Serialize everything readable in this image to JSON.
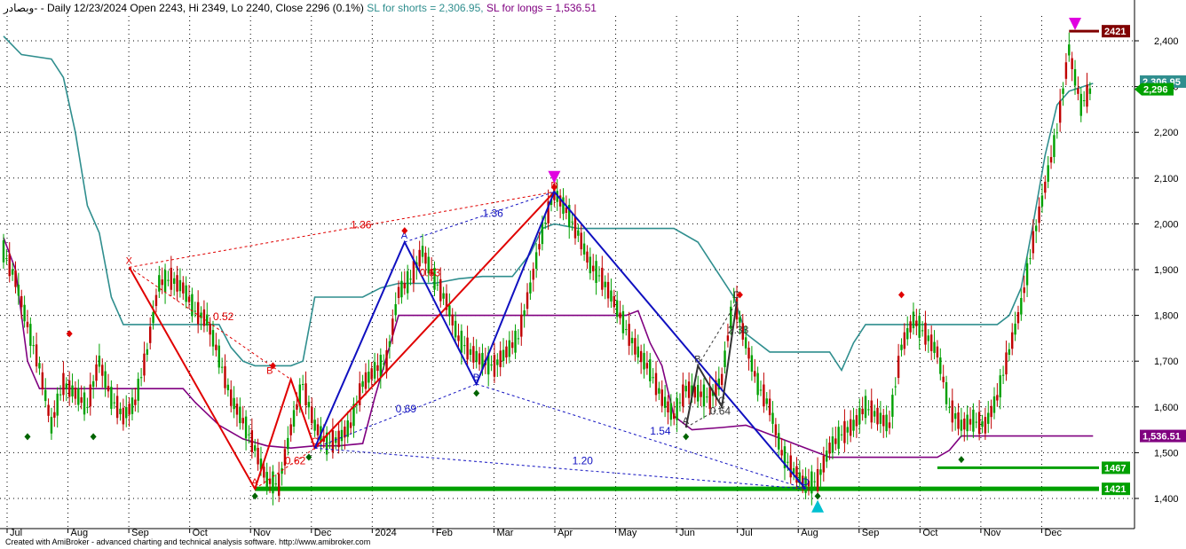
{
  "header": {
    "symbol": "وبصادر-",
    "ohlc_text": "- Daily 12/23/2024 Open 2243, Hi 2349, Lo 2240, Close 2296 (0.1%)",
    "sl_shorts_label": "SL for shorts",
    "sl_shorts_value": " = 2,306.95,",
    "sl_longs_label": "SL for longs",
    "sl_longs_value": " = 1,536.51"
  },
  "footer": "Created with AmiBroker - advanced charting and technical analysis software. http://www.amibroker.com",
  "chart_data": {
    "type": "line",
    "title": "Daily 12/23/2024 Open 2243, Hi 2349, Lo 2240, Close 2296 (0.1%)",
    "ylim": [
      1370,
      2440
    ],
    "y_ticks": [
      1400,
      1500,
      1600,
      1700,
      1800,
      1900,
      2000,
      2100,
      2200,
      2300,
      2400
    ],
    "y_tick_labels": [
      "1,400",
      "1,500",
      "1,600",
      "1,700",
      "1,800",
      "1,900",
      "2,000",
      "2,100",
      "2,200",
      "2,300",
      "2,400"
    ],
    "x_ticks": [
      "Jul",
      "Aug",
      "Sep",
      "Oct",
      "Nov",
      "Dec",
      "2024",
      "Feb",
      "Mar",
      "Apr",
      "May",
      "Jun",
      "Jul",
      "Aug",
      "Sep",
      "Oct",
      "Nov",
      "Dec"
    ],
    "grid": true,
    "colors": {
      "price": "#00a000",
      "sl_shorts": "#2f8e8e",
      "sl_longs": "#800080",
      "pattern_red": "#e00000",
      "pattern_blue": "#1010c0",
      "pattern_dark": "#333333",
      "support": "#00a000",
      "resistance": "#800000",
      "sell_marker": "#e000e0",
      "buy_marker": "#00c0d0"
    },
    "price_points": [
      [
        0,
        1940
      ],
      [
        4,
        1880
      ],
      [
        8,
        1780
      ],
      [
        12,
        1690
      ],
      [
        16,
        1560
      ],
      [
        20,
        1650
      ],
      [
        24,
        1630
      ],
      [
        28,
        1600
      ],
      [
        32,
        1700
      ],
      [
        36,
        1620
      ],
      [
        40,
        1580
      ],
      [
        44,
        1610
      ],
      [
        48,
        1720
      ],
      [
        52,
        1870
      ],
      [
        56,
        1880
      ],
      [
        60,
        1860
      ],
      [
        64,
        1810
      ],
      [
        68,
        1790
      ],
      [
        72,
        1710
      ],
      [
        76,
        1620
      ],
      [
        80,
        1570
      ],
      [
        84,
        1510
      ],
      [
        88,
        1440
      ],
      [
        92,
        1430
      ],
      [
        96,
        1550
      ],
      [
        100,
        1650
      ],
      [
        104,
        1560
      ],
      [
        108,
        1520
      ],
      [
        112,
        1530
      ],
      [
        116,
        1560
      ],
      [
        120,
        1650
      ],
      [
        124,
        1680
      ],
      [
        128,
        1700
      ],
      [
        132,
        1850
      ],
      [
        136,
        1880
      ],
      [
        140,
        1940
      ],
      [
        144,
        1880
      ],
      [
        148,
        1830
      ],
      [
        152,
        1750
      ],
      [
        156,
        1720
      ],
      [
        160,
        1700
      ],
      [
        164,
        1690
      ],
      [
        168,
        1720
      ],
      [
        172,
        1750
      ],
      [
        176,
        1860
      ],
      [
        180,
        1980
      ],
      [
        184,
        2070
      ],
      [
        188,
        2030
      ],
      [
        192,
        1980
      ],
      [
        196,
        1910
      ],
      [
        200,
        1880
      ],
      [
        204,
        1830
      ],
      [
        208,
        1770
      ],
      [
        212,
        1720
      ],
      [
        216,
        1680
      ],
      [
        220,
        1620
      ],
      [
        224,
        1580
      ],
      [
        228,
        1640
      ],
      [
        232,
        1630
      ],
      [
        236,
        1620
      ],
      [
        240,
        1660
      ],
      [
        244,
        1840
      ],
      [
        248,
        1740
      ],
      [
        252,
        1650
      ],
      [
        256,
        1600
      ],
      [
        260,
        1500
      ],
      [
        264,
        1460
      ],
      [
        268,
        1430
      ],
      [
        272,
        1440
      ],
      [
        276,
        1510
      ],
      [
        280,
        1540
      ],
      [
        284,
        1560
      ],
      [
        288,
        1600
      ],
      [
        292,
        1580
      ],
      [
        296,
        1560
      ],
      [
        300,
        1730
      ],
      [
        304,
        1790
      ],
      [
        308,
        1760
      ],
      [
        312,
        1720
      ],
      [
        316,
        1600
      ],
      [
        320,
        1560
      ],
      [
        324,
        1570
      ],
      [
        328,
        1560
      ],
      [
        332,
        1620
      ],
      [
        336,
        1720
      ],
      [
        340,
        1820
      ],
      [
        344,
        1960
      ],
      [
        348,
        2080
      ],
      [
        352,
        2200
      ],
      [
        356,
        2380
      ],
      [
        360,
        2260
      ],
      [
        364,
        2300
      ]
    ],
    "sl_shorts_series": [
      [
        0,
        2410
      ],
      [
        6,
        2370
      ],
      [
        16,
        2360
      ],
      [
        20,
        2320
      ],
      [
        24,
        2200
      ],
      [
        28,
        2040
      ],
      [
        32,
        1980
      ],
      [
        36,
        1840
      ],
      [
        40,
        1780
      ],
      [
        46,
        1780
      ],
      [
        52,
        1780
      ],
      [
        60,
        1780
      ],
      [
        66,
        1780
      ],
      [
        72,
        1780
      ],
      [
        76,
        1730
      ],
      [
        80,
        1700
      ],
      [
        84,
        1690
      ],
      [
        88,
        1690
      ],
      [
        96,
        1690
      ],
      [
        100,
        1700
      ],
      [
        104,
        1840
      ],
      [
        112,
        1840
      ],
      [
        120,
        1840
      ],
      [
        126,
        1860
      ],
      [
        132,
        1870
      ],
      [
        138,
        1870
      ],
      [
        144,
        1870
      ],
      [
        148,
        1875
      ],
      [
        152,
        1880
      ],
      [
        160,
        1885
      ],
      [
        170,
        1885
      ],
      [
        176,
        1935
      ],
      [
        180,
        1990
      ],
      [
        184,
        2000
      ],
      [
        192,
        1990
      ],
      [
        200,
        1990
      ],
      [
        212,
        1990
      ],
      [
        224,
        1990
      ],
      [
        232,
        1960
      ],
      [
        236,
        1920
      ],
      [
        240,
        1880
      ],
      [
        244,
        1840
      ],
      [
        248,
        1760
      ],
      [
        256,
        1720
      ],
      [
        264,
        1720
      ],
      [
        272,
        1720
      ],
      [
        276,
        1720
      ],
      [
        280,
        1680
      ],
      [
        284,
        1740
      ],
      [
        288,
        1780
      ],
      [
        300,
        1780
      ],
      [
        316,
        1780
      ],
      [
        332,
        1780
      ],
      [
        336,
        1800
      ],
      [
        340,
        1860
      ],
      [
        344,
        2000
      ],
      [
        348,
        2150
      ],
      [
        352,
        2260
      ],
      [
        356,
        2290
      ],
      [
        364,
        2306.95
      ]
    ],
    "sl_longs_series": [
      [
        0,
        1970
      ],
      [
        4,
        1900
      ],
      [
        8,
        1700
      ],
      [
        12,
        1640
      ],
      [
        20,
        1640
      ],
      [
        32,
        1640
      ],
      [
        44,
        1640
      ],
      [
        52,
        1640
      ],
      [
        60,
        1640
      ],
      [
        64,
        1610
      ],
      [
        72,
        1560
      ],
      [
        80,
        1530
      ],
      [
        88,
        1515
      ],
      [
        96,
        1510
      ],
      [
        104,
        1515
      ],
      [
        112,
        1515
      ],
      [
        120,
        1520
      ],
      [
        124,
        1620
      ],
      [
        132,
        1800
      ],
      [
        140,
        1800
      ],
      [
        148,
        1800
      ],
      [
        160,
        1800
      ],
      [
        176,
        1800
      ],
      [
        192,
        1800
      ],
      [
        208,
        1800
      ],
      [
        212,
        1810
      ],
      [
        216,
        1740
      ],
      [
        220,
        1690
      ],
      [
        224,
        1580
      ],
      [
        230,
        1550
      ],
      [
        240,
        1555
      ],
      [
        248,
        1560
      ],
      [
        256,
        1540
      ],
      [
        264,
        1520
      ],
      [
        272,
        1500
      ],
      [
        276,
        1490
      ],
      [
        288,
        1490
      ],
      [
        300,
        1490
      ],
      [
        312,
        1490
      ],
      [
        316,
        1505
      ],
      [
        320,
        1536.51
      ],
      [
        340,
        1536.51
      ],
      [
        364,
        1536.51
      ]
    ],
    "levels": [
      {
        "value": 1467,
        "label": "1467",
        "color": "#00a000"
      },
      {
        "value": 1421,
        "label": "1421",
        "color": "#00a000"
      },
      {
        "value": 2421,
        "label": "2421",
        "color": "#800000"
      }
    ],
    "value_tags": [
      {
        "value": 2306.95,
        "label": "2,306.95",
        "color": "#2f8e8e"
      },
      {
        "value": 2296,
        "label": "2,296",
        "color": "#00a000"
      },
      {
        "value": 1536.51,
        "label": "1,536.51",
        "color": "#800080"
      }
    ],
    "patterns": [
      {
        "color": "#e00000",
        "solid": [
          [
            [
              42,
              1905
            ],
            [
              84,
              1421
            ],
            [
              96,
              1660
            ],
            [
              104,
              1510
            ],
            [
              184,
              2070
            ]
          ]
        ],
        "dashed": [
          [
            [
              42,
              1905
            ],
            [
              96,
              1660
            ]
          ],
          [
            [
              42,
              1905
            ],
            [
              184,
              2070
            ]
          ],
          [
            [
              84,
              1421
            ],
            [
              104,
              1510
            ]
          ],
          [
            [
              104,
              1510
            ],
            [
              184,
              2070
            ]
          ]
        ],
        "points": [
          {
            "x": 42,
            "y": 1905,
            "l": "X"
          },
          {
            "x": 84,
            "y": 1421,
            "l": "A"
          },
          {
            "x": 89,
            "y": 1665,
            "l": "B"
          },
          {
            "x": 104,
            "y": 1510,
            "l": "C"
          },
          {
            "x": 184,
            "y": 2070,
            "l": "D"
          }
        ]
      },
      {
        "color": "#1010c0",
        "solid": [
          [
            [
              104,
              1510
            ],
            [
              134,
              1960
            ],
            [
              158,
              1650
            ],
            [
              184,
              2070
            ],
            [
              268,
              1421
            ]
          ]
        ],
        "dashed": [
          [
            [
              104,
              1510
            ],
            [
              158,
              1650
            ]
          ],
          [
            [
              134,
              1960
            ],
            [
              184,
              2070
            ]
          ],
          [
            [
              158,
              1650
            ],
            [
              268,
              1421
            ]
          ],
          [
            [
              104,
              1510
            ],
            [
              268,
              1421
            ]
          ]
        ],
        "points": [
          {
            "x": 134,
            "y": 1960,
            "l": "A"
          },
          {
            "x": 158,
            "y": 1650,
            "l": "B"
          },
          {
            "x": 268,
            "y": 1421,
            "l": "D"
          }
        ]
      },
      {
        "color": "#333333",
        "solid": [
          [
            [
              228,
              1555
            ],
            [
              232,
              1690
            ],
            [
              240,
              1600
            ],
            [
              245,
              1830
            ]
          ]
        ],
        "dashed": [
          [
            [
              228,
              1555
            ],
            [
              240,
              1600
            ]
          ],
          [
            [
              232,
              1690
            ],
            [
              245,
              1830
            ]
          ]
        ],
        "points": [
          {
            "x": 228,
            "y": 1555,
            "l": "A"
          },
          {
            "x": 232,
            "y": 1690,
            "l": "B"
          },
          {
            "x": 240,
            "y": 1600,
            "l": "C"
          },
          {
            "x": 245,
            "y": 1830,
            "l": "D"
          }
        ]
      }
    ],
    "annotations": [
      {
        "text": "1.36",
        "x": 116,
        "y": 1990,
        "color": "#e00000"
      },
      {
        "text": "0.52",
        "x": 70,
        "y": 1790,
        "color": "#e00000"
      },
      {
        "text": "0.62",
        "x": 94,
        "y": 1475,
        "color": "#e00000"
      },
      {
        "text": "0.63",
        "x": 139,
        "y": 1885,
        "color": "#e00000"
      },
      {
        "text": "1.36",
        "x": 160,
        "y": 2015,
        "color": "#1010c0"
      },
      {
        "text": "0.69",
        "x": 131,
        "y": 1588,
        "color": "#1010c0"
      },
      {
        "text": "1.54",
        "x": 216,
        "y": 1540,
        "color": "#1010c0"
      },
      {
        "text": "1.20",
        "x": 190,
        "y": 1475,
        "color": "#1010c0"
      },
      {
        "text": "0.64",
        "x": 236,
        "y": 1583,
        "color": "#333333"
      },
      {
        "text": "2.33",
        "x": 242,
        "y": 1760,
        "color": "#333333"
      }
    ],
    "sell_markers": [
      {
        "x": 184,
        "y": 2100
      },
      {
        "x": 358,
        "y": 2435
      }
    ],
    "buy_markers": [
      {
        "x": 272,
        "y": 1385
      }
    ],
    "pivot_highs": [
      {
        "x": 22,
        "y": 1760
      },
      {
        "x": 90,
        "y": 1690
      },
      {
        "x": 134,
        "y": 1985
      },
      {
        "x": 184,
        "y": 2080
      },
      {
        "x": 246,
        "y": 1845
      },
      {
        "x": 300,
        "y": 1845
      }
    ],
    "pivot_lows": [
      {
        "x": 8,
        "y": 1535
      },
      {
        "x": 30,
        "y": 1535
      },
      {
        "x": 84,
        "y": 1405
      },
      {
        "x": 102,
        "y": 1490
      },
      {
        "x": 158,
        "y": 1630
      },
      {
        "x": 228,
        "y": 1535
      },
      {
        "x": 272,
        "y": 1405
      },
      {
        "x": 320,
        "y": 1485
      }
    ]
  }
}
